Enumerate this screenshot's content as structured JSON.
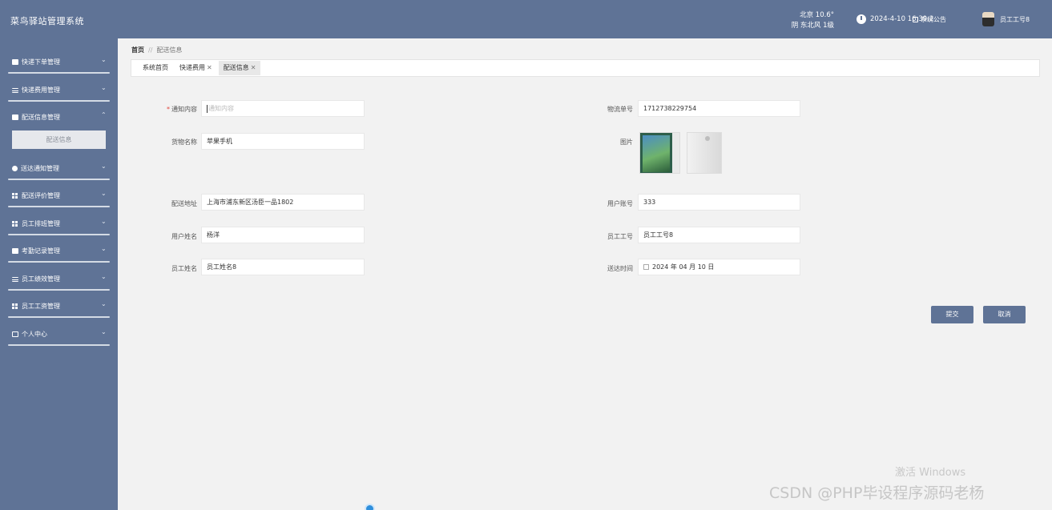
{
  "header": {
    "app_title": "菜鸟驿站管理系统",
    "weather_line1": "北京  10.6°",
    "weather_line2": "阴  东北风  1级",
    "datetime": "2024-4-10 16:39:2",
    "notice_label": "系统公告",
    "user_name": "员工工号8",
    "icons": [
      "clock-icon",
      "speaker-icon",
      "avatar"
    ]
  },
  "sidebar": {
    "items": [
      {
        "label": "快递下单管理",
        "icon": "monitor-icon"
      },
      {
        "label": "快递费用管理",
        "icon": "list-icon"
      },
      {
        "label": "配送信息管理",
        "icon": "monitor-icon",
        "expanded": true
      },
      {
        "label": "送达通知管理",
        "icon": "pin-icon"
      },
      {
        "label": "配送评价管理",
        "icon": "grid-icon"
      },
      {
        "label": "员工排班管理",
        "icon": "grid-icon"
      },
      {
        "label": "考勤记录管理",
        "icon": "comment-icon"
      },
      {
        "label": "员工绩效管理",
        "icon": "sliders-icon"
      },
      {
        "label": "员工工资管理",
        "icon": "grid-icon"
      },
      {
        "label": "个人中心",
        "icon": "id-card-icon"
      }
    ],
    "submenu": {
      "label": "配送信息"
    }
  },
  "breadcrumb": {
    "home": "首页",
    "separator": "//",
    "current": "配送信息"
  },
  "tabs": [
    {
      "label": "系统首页",
      "closable": false
    },
    {
      "label": "快递费用",
      "closable": true
    },
    {
      "label": "配送信息",
      "closable": true,
      "active": true
    }
  ],
  "form": {
    "notify_content": {
      "label": "通知内容",
      "required": true,
      "placeholder": "通知内容",
      "value": ""
    },
    "tracking_no": {
      "label": "物流单号",
      "value": "1712738229754"
    },
    "goods_name": {
      "label": "货物名称",
      "value": "苹果手机"
    },
    "image": {
      "label": "图片"
    },
    "address": {
      "label": "配送地址",
      "value": "上海市浦东新区汤臣一品1802"
    },
    "user_account": {
      "label": "用户账号",
      "value": "333"
    },
    "user_name": {
      "label": "用户姓名",
      "value": "杨洋"
    },
    "staff_no": {
      "label": "员工工号",
      "value": "员工工号8"
    },
    "staff_name": {
      "label": "员工姓名",
      "value": "员工姓名8"
    },
    "delivered_time": {
      "label": "送达时间",
      "value": "2024 年 04 月 10 日"
    }
  },
  "buttons": {
    "submit": "提交",
    "cancel": "取消"
  },
  "watermarks": {
    "windows": "激活 Windows",
    "csdn": "CSDN @PHP毕设程序源码老杨"
  },
  "colors": {
    "primary": "#5f7396",
    "required": "#e0443b"
  }
}
